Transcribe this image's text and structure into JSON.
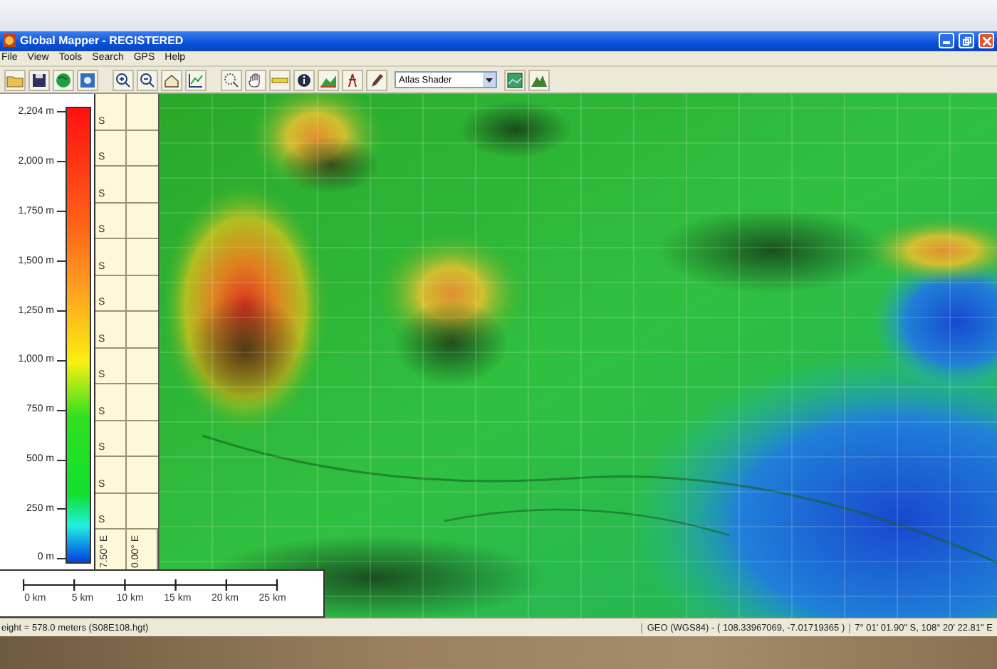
{
  "window": {
    "title": "Global Mapper - REGISTERED"
  },
  "menu": [
    "File",
    "View",
    "Tools",
    "Search",
    "GPS",
    "Help"
  ],
  "toolbar": {
    "dropdown": "Atlas Shader"
  },
  "legend": {
    "labels": [
      "2,204 m",
      "2,000 m",
      "1,750 m",
      "1,500 m",
      "1,250 m",
      "1,000 m",
      "750 m",
      "500 m",
      "250 m",
      "0 m"
    ]
  },
  "grid_strip": {
    "row_labels": [
      "S",
      "S",
      "S",
      "S",
      "S",
      "S",
      "S",
      "S",
      "S",
      "S",
      "S",
      "S"
    ],
    "column_labels": [
      "7.50° E",
      "0.00° E"
    ]
  },
  "scale_bar": {
    "labels": [
      "0 km",
      "5 km",
      "10 km",
      "15 km",
      "20 km",
      "25 km"
    ]
  },
  "status_bar": {
    "height": "eight = 578.0 meters (S08E108.hgt)",
    "projection": "GEO (WGS84) - ( 108.33967069, -7.01719365 )",
    "position": "7° 01' 01.90\" S, 108° 20' 22.81\" E"
  }
}
